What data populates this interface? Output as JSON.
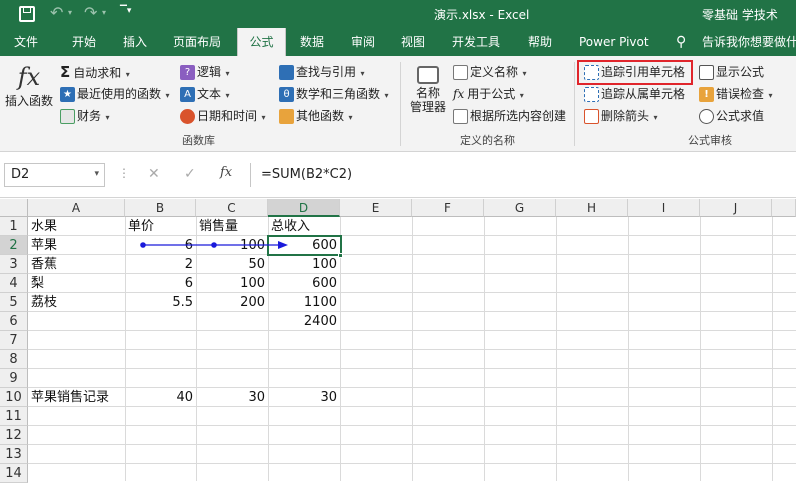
{
  "titlebar": {
    "title": "演示.xlsx  -  Excel",
    "user": "零基础 学技术"
  },
  "tabs": [
    "文件",
    "开始",
    "插入",
    "页面布局",
    "公式",
    "数据",
    "审阅",
    "视图",
    "开发工具",
    "帮助",
    "Power Pivot"
  ],
  "tell_me": "告诉我你想要做什",
  "ribbon": {
    "insert_function": "插入函数",
    "autosum": "自动求和",
    "recent": "最近使用的函数",
    "financial": "财务",
    "logical": "逻辑",
    "text": "文本",
    "datetime": "日期和时间",
    "lookup": "查找与引用",
    "math": "数学和三角函数",
    "other": "其他函数",
    "group_library": "函数库",
    "name_manager": [
      "名称",
      "管理器"
    ],
    "define_name": "定义名称",
    "use_in_formula": "用于公式",
    "create_from_selection": "根据所选内容创建",
    "group_names": "定义的名称",
    "trace_precedents": "追踪引用单元格",
    "trace_dependents": "追踪从属单元格",
    "remove_arrows": "删除箭头",
    "show_formulas": "显示公式",
    "error_checking": "错误检查",
    "evaluate_formula": "公式求值",
    "group_audit": "公式审核"
  },
  "formula_bar": {
    "name_box": "D2",
    "fx": "fx",
    "formula": "=SUM(B2*C2)"
  },
  "columns": [
    "A",
    "B",
    "C",
    "D",
    "E",
    "F",
    "G",
    "H",
    "I",
    "J"
  ],
  "rows": [
    "1",
    "2",
    "3",
    "4",
    "5",
    "6",
    "7",
    "8",
    "9",
    "10",
    "11",
    "12",
    "13",
    "14"
  ],
  "cells": {
    "A1": "水果",
    "B1": "单价",
    "C1": "销售量",
    "D1": "总收入",
    "A2": "苹果",
    "B2": "6",
    "C2": "100",
    "D2": "600",
    "A3": "香蕉",
    "B3": "2",
    "C3": "50",
    "D3": "100",
    "A4": "梨",
    "B4": "6",
    "C4": "100",
    "D4": "600",
    "A5": "荔枝",
    "B5": "5.5",
    "C5": "200",
    "D5": "1100",
    "D6": "2400",
    "A10": "苹果销售记录",
    "B10": "40",
    "C10": "30",
    "D10": "30"
  },
  "colors": {
    "brand": "#217346",
    "highlight_box": "#e0252b",
    "trace_arrow": "#1a1adb"
  }
}
